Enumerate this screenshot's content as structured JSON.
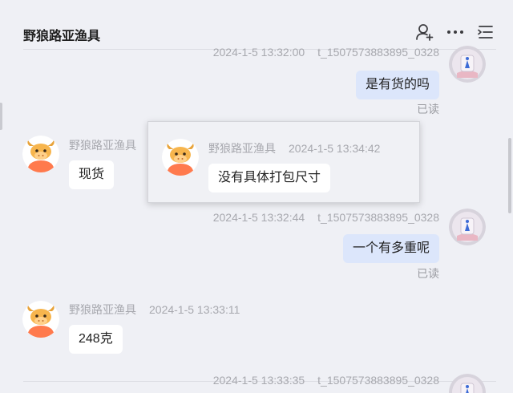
{
  "header": {
    "title": "野狼路亚渔具"
  },
  "messages": [
    {
      "sender": "t_1507573883895_0328",
      "time": "2024-1-5 13:32:00",
      "text": "是有货的吗",
      "status": "已读"
    },
    {
      "sender": "野狼路亚渔具",
      "text": "现货"
    },
    {
      "sender": "t_1507573883895_0328",
      "time": "2024-1-5 13:32:44",
      "text": "一个有多重呢",
      "status": "已读"
    },
    {
      "sender": "野狼路亚渔具",
      "time": "2024-1-5 13:33:11",
      "text": "248克"
    },
    {
      "sender": "t_1507573883895_0328",
      "time": "2024-1-5 13:33:35"
    }
  ],
  "popup": {
    "sender": "野狼路亚渔具",
    "time": "2024-1-5 13:34:42",
    "text": "没有具体打包尺寸"
  },
  "icons": {
    "add_contact": "person-plus-icon",
    "more": "ellipsis-icon",
    "menu": "list-menu-icon"
  },
  "colors": {
    "background": "#eff0f5",
    "bubble_self": "#dce6fb",
    "bubble_other": "#ffffff",
    "avatar_shop": "#ff7a4d"
  }
}
